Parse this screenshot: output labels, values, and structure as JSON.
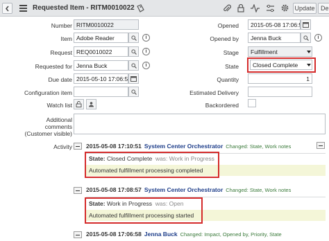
{
  "header": {
    "title": "Requested Item - RITM0010022",
    "update_label": "Update",
    "overflow_label": "De"
  },
  "form": {
    "number_label": "Number",
    "number_value": "RITM0010022",
    "item_label": "Item",
    "item_value": "Adobe Reader",
    "request_label": "Request",
    "request_value": "REQ0010022",
    "requested_for_label": "Requested for",
    "requested_for_value": "Jenna Buck",
    "due_date_label": "Due date",
    "due_date_value": "2015-05-10 17:06:5",
    "config_item_label": "Configuration item",
    "config_item_value": "",
    "watch_list_label": "Watch list",
    "opened_label": "Opened",
    "opened_value": "2015-05-08 17:06:5",
    "opened_by_label": "Opened by",
    "opened_by_value": "Jenna Buck",
    "stage_label": "Stage",
    "stage_value": "Fulfillment",
    "state_label": "State",
    "state_value": "Closed Complete",
    "quantity_label": "Quantity",
    "quantity_value": "1",
    "estimated_delivery_label": "Estimated Delivery",
    "estimated_delivery_value": "",
    "backordered_label": "Backordered",
    "additional_comments_label_1": "Additional",
    "additional_comments_label_2": "comments",
    "additional_comments_label_3": "(Customer visible)",
    "activity_label": "Activity"
  },
  "activity": [
    {
      "time": "2015-05-08 17:10:51",
      "user": "System Center Orchestrator",
      "changed": "Changed:  State, Work notes",
      "state_key": "State:",
      "state_value": "Closed Complete",
      "was_label": "was:",
      "was_value": "Work in Progress",
      "note": "Automated fulfillment processing completed"
    },
    {
      "time": "2015-05-08 17:08:57",
      "user": "System Center Orchestrator",
      "changed": "Changed:  State, Work notes",
      "state_key": "State:",
      "state_value": "Work in Progress",
      "was_label": "was:",
      "was_value": "Open",
      "note": "Automated fulfillment processing started"
    },
    {
      "time": "2015-05-08 17:06:58",
      "user": "Jenna Buck",
      "changed": "Changed:  Impact, Opened by, Priority, State"
    }
  ],
  "icons": {
    "back": "chevron-left-icon",
    "menu": "hamburger-menu-icon",
    "attachment": "paperclip-icon",
    "ticket": "ticket-icon",
    "activity": "activity-pulse-icon",
    "settings": "gear-icon",
    "lookup": "magnifier-icon",
    "info": "info-circle-icon",
    "lock": "lock-icon",
    "add_me": "add-me-icon"
  },
  "colors": {
    "highlight_box": "#d42a2a",
    "user_link": "#1e3e8a",
    "changed_text": "#3a7a3a",
    "note_bg": "#f4f6d8"
  }
}
